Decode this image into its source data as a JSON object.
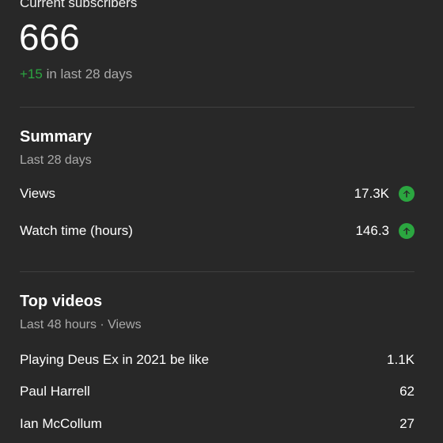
{
  "subscribers": {
    "label": "Current subscribers",
    "count": "666",
    "delta": "+15",
    "delta_suffix": " in last 28 days"
  },
  "summary": {
    "title": "Summary",
    "period": "Last 28 days",
    "rows": [
      {
        "label": "Views",
        "value": "17.3K",
        "trend": "up-arrow-icon"
      },
      {
        "label": "Watch time (hours)",
        "value": "146.3",
        "trend": "up-arrow-icon"
      }
    ]
  },
  "top_videos": {
    "title": "Top videos",
    "period": "Last 48 hours · Views",
    "items": [
      {
        "title": "Playing Deus Ex in 2021 be like",
        "views": "1.1K"
      },
      {
        "title": "Paul Harrell",
        "views": "62"
      },
      {
        "title": "Ian McCollum",
        "views": "27"
      }
    ]
  },
  "colors": {
    "background": "#282828",
    "positive": "#2ba640",
    "secondary_text": "#aaaaaa"
  }
}
